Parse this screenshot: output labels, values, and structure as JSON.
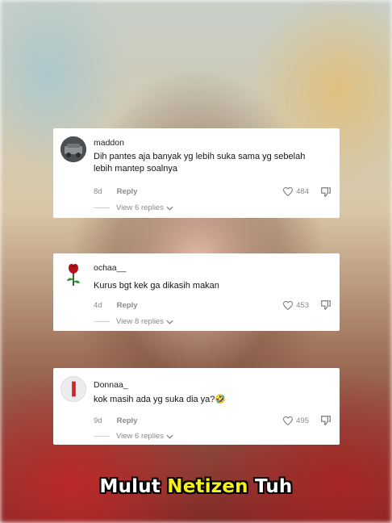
{
  "comments": [
    {
      "username": "maddon",
      "text": "Dih pantes aja banyak yg lebih suka sama yg sebelah lebih mantep soalnya",
      "time": "8d",
      "reply_label": "Reply",
      "likes": "484",
      "view_replies": "View 6 replies",
      "avatar_icon": "photo-avatar"
    },
    {
      "username": "ochaa__",
      "text": "Kurus bgt kek ga dikasih makan",
      "time": "4d",
      "reply_label": "Reply",
      "likes": "453",
      "view_replies": "View 8 replies",
      "avatar_icon": "rose-icon"
    },
    {
      "username": "Donnaa_",
      "text": "kok masih ada yg suka dia ya?🤣",
      "time": "9d",
      "reply_label": "Reply",
      "likes": "495",
      "view_replies": "View 6 replies",
      "avatar_icon": "red-bar-avatar"
    }
  ],
  "caption": {
    "part1": "Mulut ",
    "highlight": "Netizen",
    "part2": " Tuh",
    "highlight_color": "#f6f219"
  }
}
